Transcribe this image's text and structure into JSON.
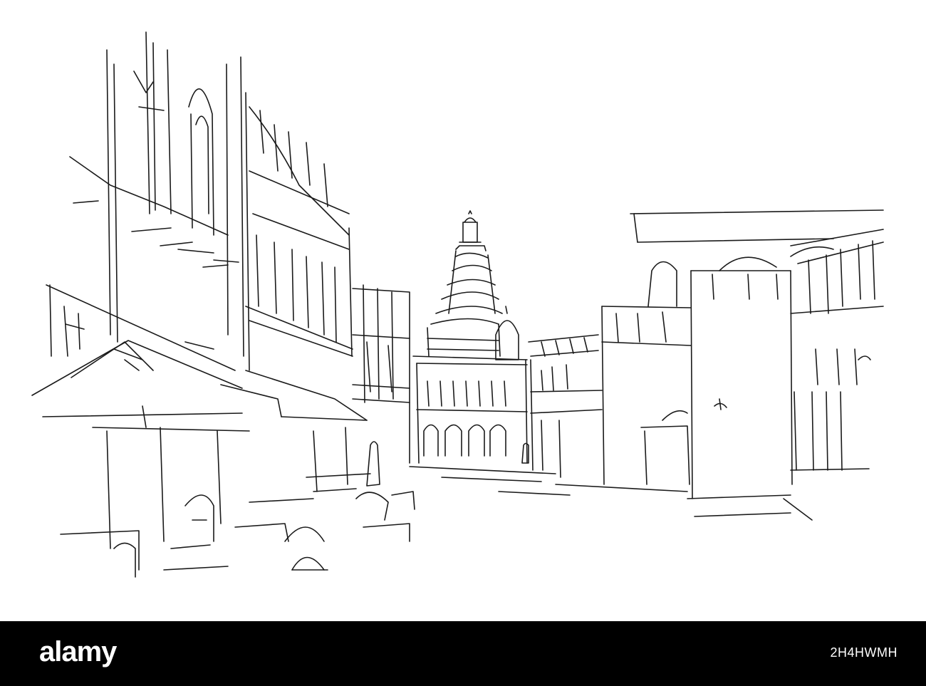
{
  "image": {
    "subject_icon": "street-scene-sketch-icon",
    "stroke_color": "#1a1a1a",
    "background_color": "#ffffff"
  },
  "footer": {
    "background_color": "#000000",
    "text_color": "#ffffff",
    "logo_text": "alamy",
    "image_id": "2H4HWMH"
  }
}
